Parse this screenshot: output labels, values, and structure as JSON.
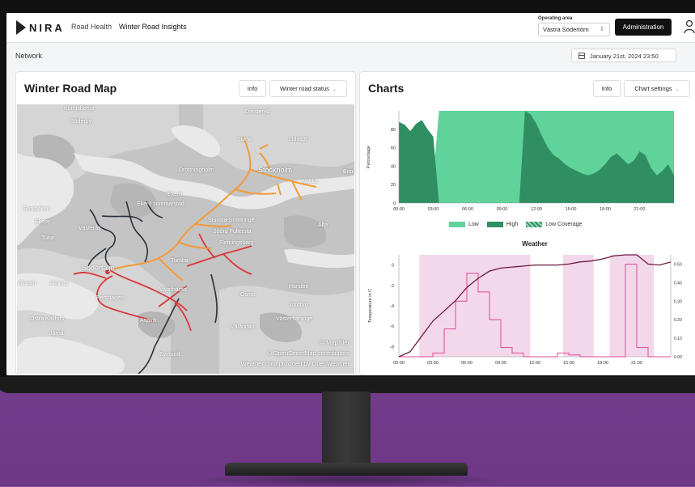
{
  "header": {
    "logo": "NIRA",
    "nav": [
      "Road Health",
      "Winter Road Insights"
    ],
    "operating_area_label": "Operating area",
    "operating_area_value": "Västra Södertörn",
    "admin_button": "Administration",
    "user_icon": "user-icon"
  },
  "breadcrumb": "Network",
  "datetime": "January 21st, 2024 23:50",
  "map_panel": {
    "title": "Winter Road Map",
    "info_button": "Info",
    "status_button": "Winter road status",
    "labels": {
      "stockholm": "Stockholm",
      "sodertalje": "Södertälje",
      "tumba": "Tumba",
      "sollentuna": "Sollentuna",
      "vasteras": "Västerås",
      "nacka": "Nacka",
      "haninge": "Handen",
      "nynas": "Ösmo",
      "ekero": "Ekerö",
      "huddinge": "Huddinge",
      "jarna": "Järna",
      "almnas": "Almnäs",
      "pershagen": "Pershagen",
      "kungsberga": "Kungsberga",
      "soderby": "Söderby",
      "drottningholm": "Drottningholm",
      "danderyd": "Danderyd",
      "lidingo": "Lidingö",
      "solna": "Solna",
      "stuvsta": "Stuvsta-Snättringe",
      "sodra": "Södra Fullersta",
      "fleminge": "Flemingsberg",
      "sandviken": "Sandviken",
      "ekeby": "Ekeby",
      "tuna": "Tuna",
      "vagsnas": "Vagnhärad",
      "jordbro": "Jordbro",
      "vasterhaninge": "Västerhaninge",
      "osterjarna": "Östra Kallfors",
      "jarna2": "Järna",
      "ostra": "Östra",
      "alta": "Älta",
      "boo": "Boo",
      "vikvam": "Vikvarn",
      "ekerojunct": "Ekerö sommarstad",
      "ekeby2": "Ekeby",
      "aspvik": "Aspvik",
      "vitsand": "Vitsand",
      "vallsta": "Vallstanäs",
      "evelund": "Evelund",
      "valandan": "Väländan",
      "osterhaninge": "Österhaninge"
    },
    "attribution": [
      "© MapTiler",
      "© OpenStreetMap contributors",
      "Weather data provided by OpenWeather"
    ]
  },
  "chart_panel": {
    "title": "Charts",
    "info_button": "Info",
    "settings_button": "Chart settings",
    "weather_title": "Weather",
    "legend": [
      "Low",
      "High",
      "Low Coverage"
    ]
  },
  "chart_data": [
    {
      "type": "area",
      "ylabel": "Percentage",
      "ylim": [
        0,
        100
      ],
      "yticks": [
        0,
        20,
        40,
        60,
        80
      ],
      "xticks": [
        "00:00",
        "03:00",
        "06:00",
        "09:00",
        "12:00",
        "15:00",
        "18:00",
        "21:00"
      ],
      "x_hours": [
        0,
        0.5,
        1,
        1.5,
        2,
        2.5,
        3,
        3.5,
        4,
        4.5,
        5,
        5.5,
        6,
        6.5,
        7,
        7.5,
        8,
        8.5,
        9,
        9.5,
        10,
        10.5,
        11,
        11.5,
        12,
        12.5,
        13,
        13.5,
        14,
        14.5,
        15,
        15.5,
        16,
        16.5,
        17,
        17.5,
        18,
        18.5,
        19,
        19.5,
        20,
        20.5,
        21,
        21.5,
        22,
        22.5,
        23,
        23.5,
        24
      ],
      "series": [
        {
          "name": "Low",
          "values": [
            12,
            15,
            22,
            14,
            10,
            20,
            28,
            100,
            100,
            100,
            100,
            100,
            100,
            100,
            100,
            100,
            100,
            100,
            100,
            100,
            100,
            100,
            100,
            100,
            100,
            100,
            100,
            100,
            100,
            100,
            100,
            100,
            100,
            100,
            100,
            100,
            100,
            100,
            100,
            100,
            100,
            100,
            100,
            100,
            100,
            100,
            100,
            100,
            100
          ]
        },
        {
          "name": "High",
          "values": [
            88,
            85,
            78,
            86,
            90,
            80,
            72,
            0,
            0,
            0,
            0,
            0,
            0,
            0,
            0,
            0,
            0,
            0,
            0,
            0,
            0,
            0,
            100,
            96,
            86,
            72,
            60,
            52,
            48,
            42,
            38,
            35,
            32,
            30,
            32,
            36,
            42,
            50,
            54,
            48,
            42,
            46,
            56,
            52,
            38,
            30,
            35,
            42,
            30
          ]
        }
      ]
    },
    {
      "type": "line",
      "title": "Weather",
      "ylabel": "Temperature in C",
      "y2label": "Snow volume mm/h",
      "ylim": [
        -9,
        1
      ],
      "yticks": [
        0,
        -2,
        -4,
        -6,
        -8
      ],
      "y2ticks": [
        "0.50",
        "0.40",
        "0.30",
        "0.20",
        "0.10",
        "0.00"
      ],
      "xticks": [
        "00:00",
        "03:00",
        "06:00",
        "09:00",
        "12:00",
        "15:00",
        "18:00",
        "21:00"
      ],
      "x_hours": [
        0,
        1,
        2,
        3,
        4,
        5,
        6,
        7,
        8,
        9,
        10,
        11,
        12,
        13,
        14,
        15,
        16,
        17,
        18,
        19,
        20,
        21,
        22,
        23,
        24
      ],
      "series": [
        {
          "name": "Temperature",
          "values": [
            -9,
            -8.5,
            -7,
            -5.5,
            -4.5,
            -3.5,
            -2.2,
            -1.3,
            -0.6,
            -0.3,
            -0.2,
            -0.1,
            0,
            0,
            0,
            0.1,
            0.3,
            0.4,
            0.6,
            0.9,
            1.0,
            1.0,
            0.1,
            0,
            0.3
          ]
        },
        {
          "name": "Snow volume",
          "values": [
            0,
            0,
            0,
            0.02,
            0.15,
            0.3,
            0.45,
            0.35,
            0.2,
            0.05,
            0.02,
            0,
            0,
            0,
            0.02,
            0.01,
            0,
            0,
            0,
            0,
            0.5,
            0.05,
            0,
            0,
            0
          ]
        }
      ],
      "shaded_hours": [
        [
          1.8,
          11.6
        ],
        [
          14.5,
          17.2
        ],
        [
          18.6,
          22.5
        ]
      ]
    }
  ],
  "colors": {
    "low": "#5fd39a",
    "high": "#2f8f62",
    "coverage": "#9ed7b8",
    "temp_line": "#6b1a3e",
    "snow_line": "#e04a9a",
    "shade": "#f3d8ea",
    "road_orange": "#f39a3a",
    "road_red": "#d9383a",
    "road_dark": "#2a2f3a"
  }
}
